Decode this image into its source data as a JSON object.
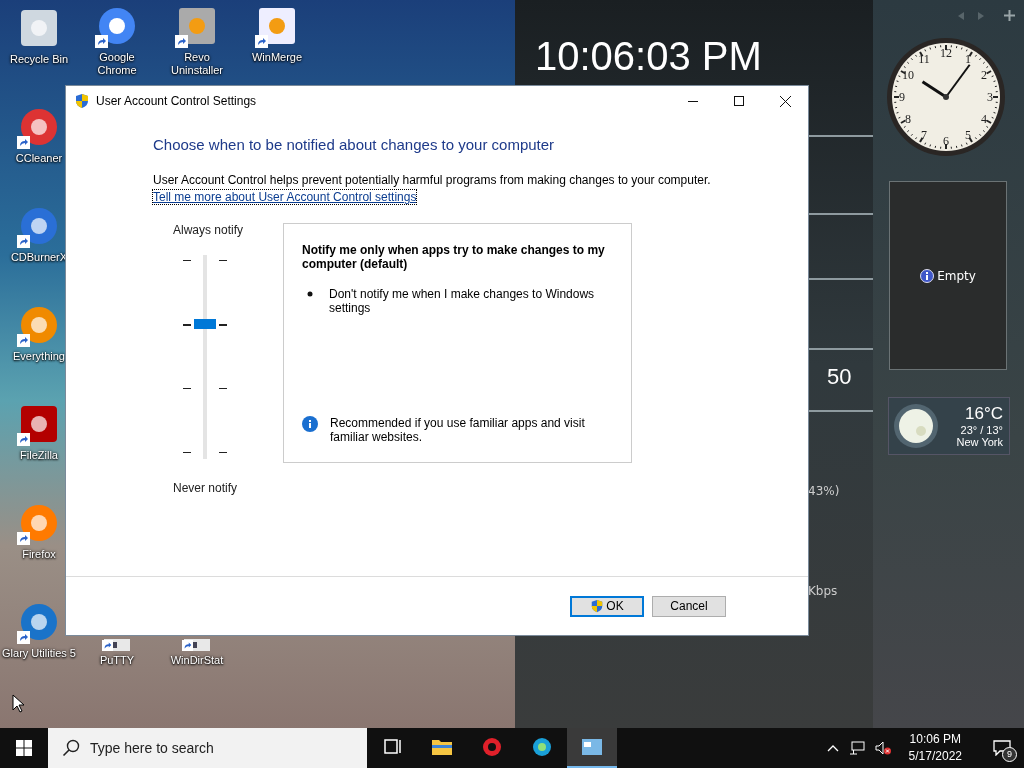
{
  "desktop": {
    "left_column": [
      {
        "label": "Recycle Bin",
        "shortcut": false
      },
      {
        "label": "CCleaner",
        "shortcut": true
      },
      {
        "label": "CDBurnerX",
        "shortcut": true
      },
      {
        "label": "Everything",
        "shortcut": true
      },
      {
        "label": "FileZilla",
        "shortcut": true
      },
      {
        "label": "Firefox",
        "shortcut": true
      },
      {
        "label": "Glary Utilities 5",
        "shortcut": true
      }
    ],
    "top_row": [
      {
        "label": "Google Chrome",
        "shortcut": true
      },
      {
        "label": "Revo Uninstaller",
        "shortcut": true
      },
      {
        "label": "WinMerge",
        "shortcut": true
      }
    ],
    "bottom_row": [
      {
        "label": "PuTTY",
        "shortcut": true
      },
      {
        "label": "WinDirStat",
        "shortcut": true
      }
    ]
  },
  "gadget_panel": {
    "clock_text": "10:06:03 PM",
    "reading": "50",
    "percent": "43%)",
    "speed": "Kbps"
  },
  "sidebar": {
    "clock_numerals": [
      "12",
      "1",
      "2",
      "3",
      "4",
      "5",
      "6",
      "7",
      "8",
      "9",
      "10",
      "11"
    ],
    "slideshow_text": "Empty",
    "weather": {
      "temperature": "16°C",
      "range": "23° / 13°",
      "city": "New York"
    }
  },
  "window": {
    "title": "User Account Control Settings",
    "heading": "Choose when to be notified about changes to your computer",
    "description": "User Account Control helps prevent potentially harmful programs from making changes to your computer.",
    "link": "Tell me more about User Account Control settings",
    "slider": {
      "top_label": "Always notify",
      "bottom_label": "Never notify",
      "level": 0.667
    },
    "info": {
      "title": "Notify me only when apps try to make changes to my computer (default)",
      "bullets": [
        "Don't notify me when I make changes to Windows settings"
      ],
      "note": "Recommended if you use familiar apps and visit familiar websites."
    },
    "buttons": [
      {
        "label": "OK",
        "default": true,
        "shield": true
      },
      {
        "label": "Cancel",
        "default": false,
        "shield": false
      }
    ]
  },
  "taskbar": {
    "search": {
      "placeholder": "Type here to search"
    },
    "apps": [
      {
        "active": false
      },
      {
        "active": false
      },
      {
        "active": false
      },
      {
        "active": false
      },
      {
        "active": true
      }
    ],
    "time": "10:06 PM",
    "date": "5/17/2022",
    "notification_count": "9"
  }
}
